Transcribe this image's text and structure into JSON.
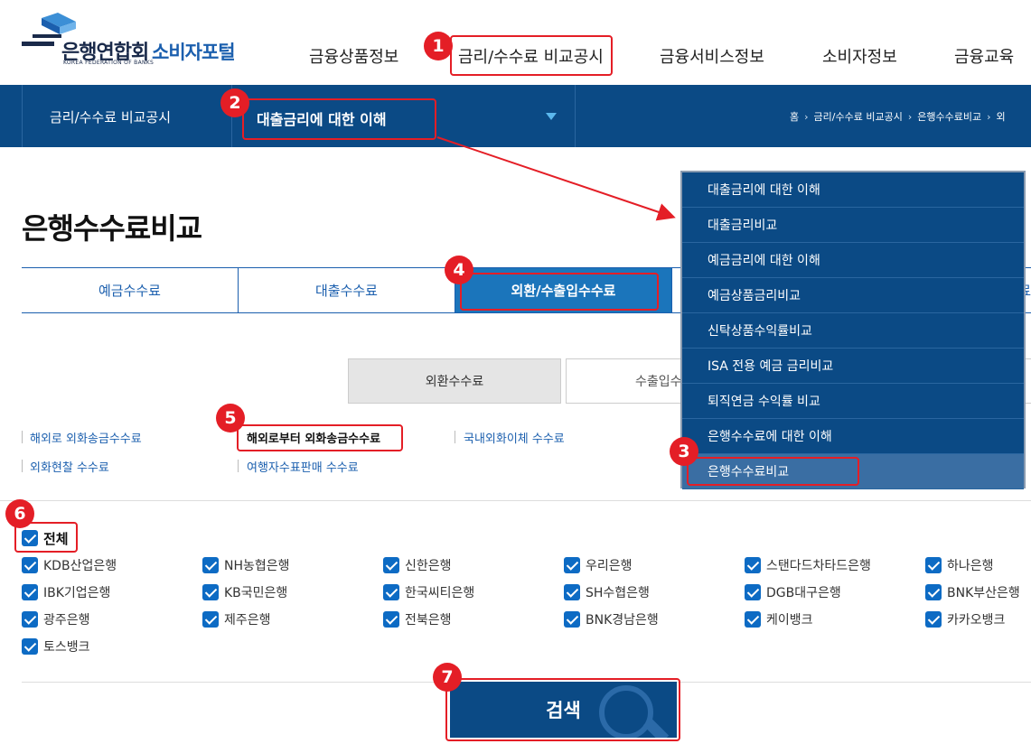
{
  "header": {
    "logo_name": "은행연합회",
    "logo_sub": "KOREA FEDERATION OF BANKS",
    "portal": "소비자포털",
    "menu": [
      "금융상품정보",
      "금리/수수료 비교공시",
      "금융서비스정보",
      "소비자정보",
      "금융교육"
    ]
  },
  "subnav": {
    "title": "금리/수수료 비교공시",
    "selected": "대출금리에 대한 이해",
    "breadcrumb": [
      "홈",
      "금리/수수료 비교공시",
      "은행수수료비교",
      "외"
    ]
  },
  "page_title": "은행수수료비교",
  "tabs": [
    "예금수수료",
    "대출수수료",
    "외환/수출입수수료",
    "료"
  ],
  "subtabs": [
    "외환수수료",
    "수출입수"
  ],
  "links": {
    "row1": [
      "해외로 외화송금수수료",
      "해외로부터 외화송금수수료",
      "국내외화이체 수수료"
    ],
    "row2": [
      "외화현찰 수수료",
      "여행자수표판매 수수료"
    ]
  },
  "checkbox_all": "전체",
  "banks": [
    "KDB산업은행",
    "NH농협은행",
    "신한은행",
    "우리은행",
    "스탠다드차타드은행",
    "하나은행",
    "IBK기업은행",
    "KB국민은행",
    "한국씨티은행",
    "SH수협은행",
    "DGB대구은행",
    "BNK부산은행",
    "광주은행",
    "제주은행",
    "전북은행",
    "BNK경남은행",
    "케이뱅크",
    "카카오뱅크",
    "토스뱅크"
  ],
  "search_label": "검색",
  "dropdown": [
    "대출금리에 대한 이해",
    "대출금리비교",
    "예금금리에 대한 이해",
    "예금상품금리비교",
    "신탁상품수익률비교",
    "ISA 전용 예금 금리비교",
    "퇴직연금 수익률 비교",
    "은행수수료에 대한 이해",
    "은행수수료비교"
  ],
  "annotations": [
    "1",
    "2",
    "3",
    "4",
    "5",
    "6",
    "7"
  ],
  "colors": {
    "primary": "#0b4a85",
    "accent": "#1b75bb",
    "annotation": "#e41e26",
    "checkbox": "#0d6bc4"
  }
}
